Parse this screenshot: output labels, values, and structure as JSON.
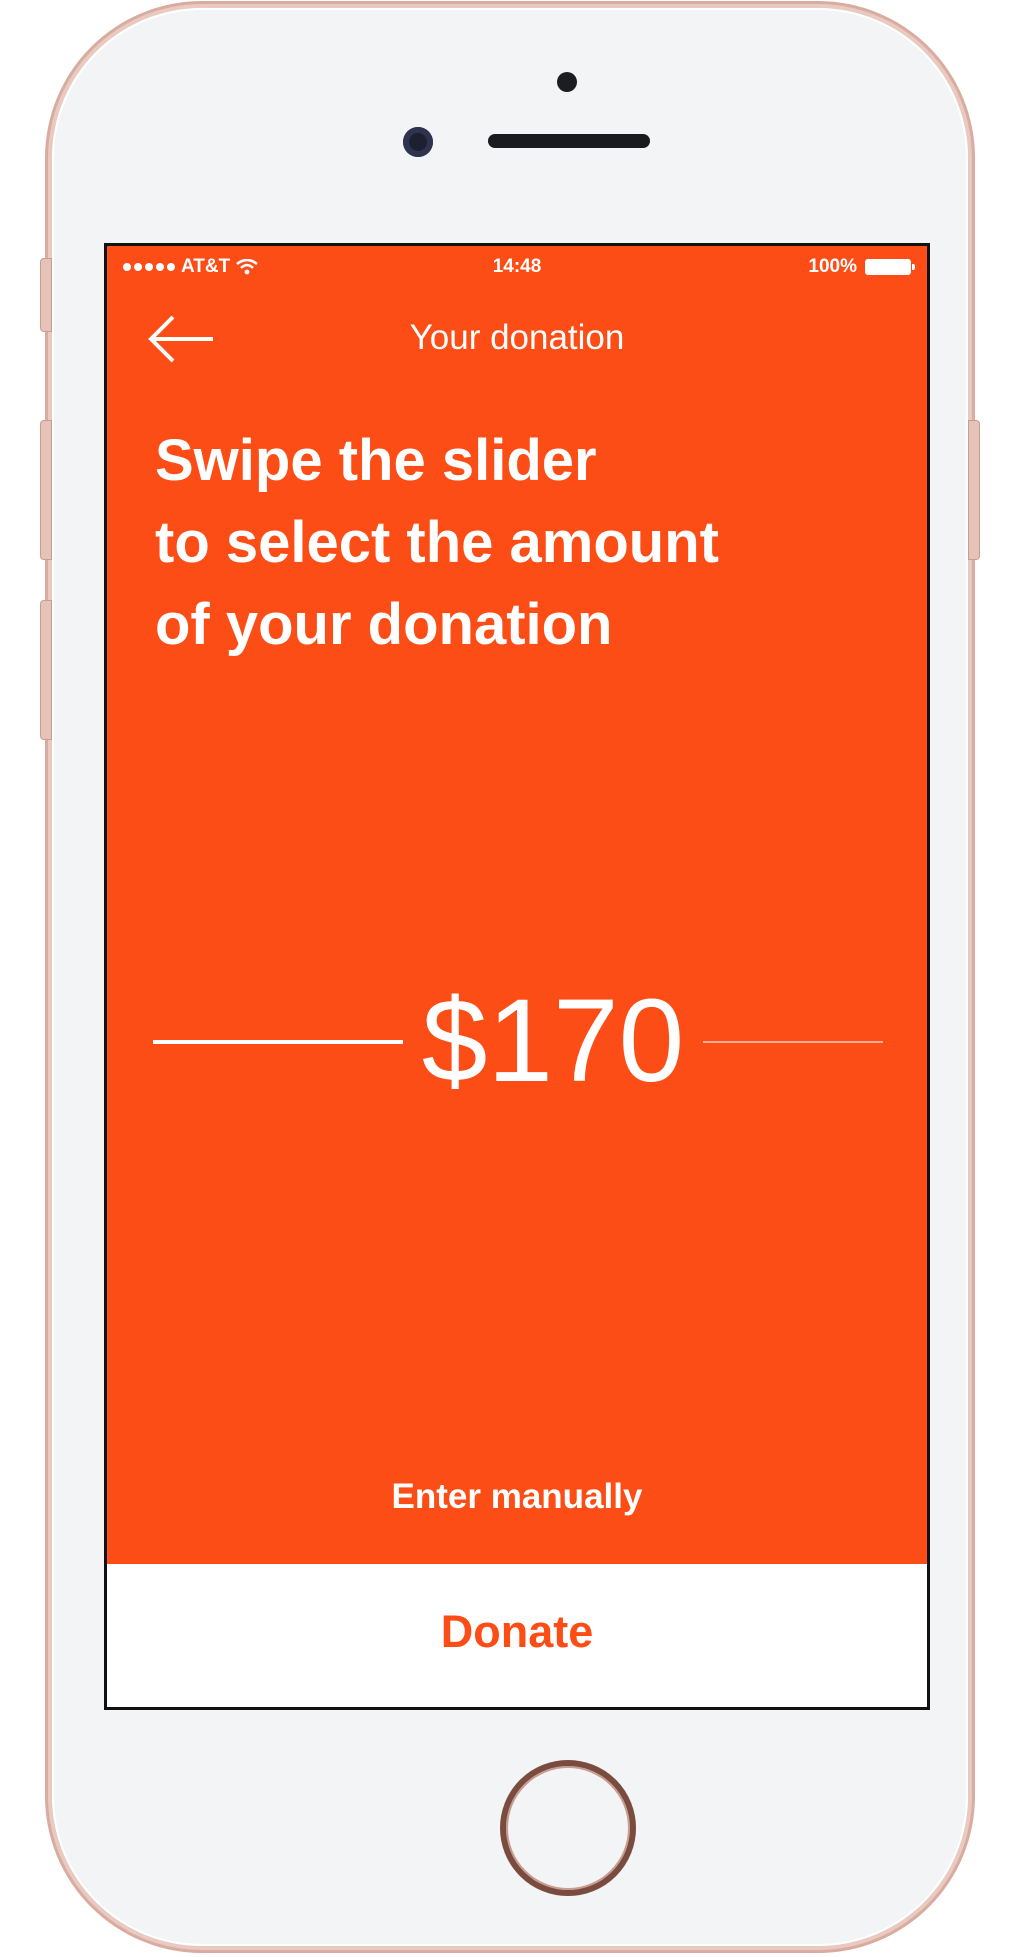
{
  "status_bar": {
    "carrier": "AT&T",
    "time": "14:48",
    "battery": "100%",
    "wifi_icon": "wifi-icon",
    "battery_icon": "battery-icon"
  },
  "nav": {
    "title": "Your donation",
    "back_icon": "arrow-left-icon"
  },
  "headline": {
    "lines": [
      "Swipe the slider",
      "to select the amount",
      "of your donation"
    ]
  },
  "slider": {
    "amount": "$170"
  },
  "links": {
    "enter_manually": "Enter manually"
  },
  "actions": {
    "donate": "Donate"
  },
  "colors": {
    "accent": "#fc4d16",
    "text_on_accent": "#ffffff",
    "button_background": "#ffffff"
  }
}
